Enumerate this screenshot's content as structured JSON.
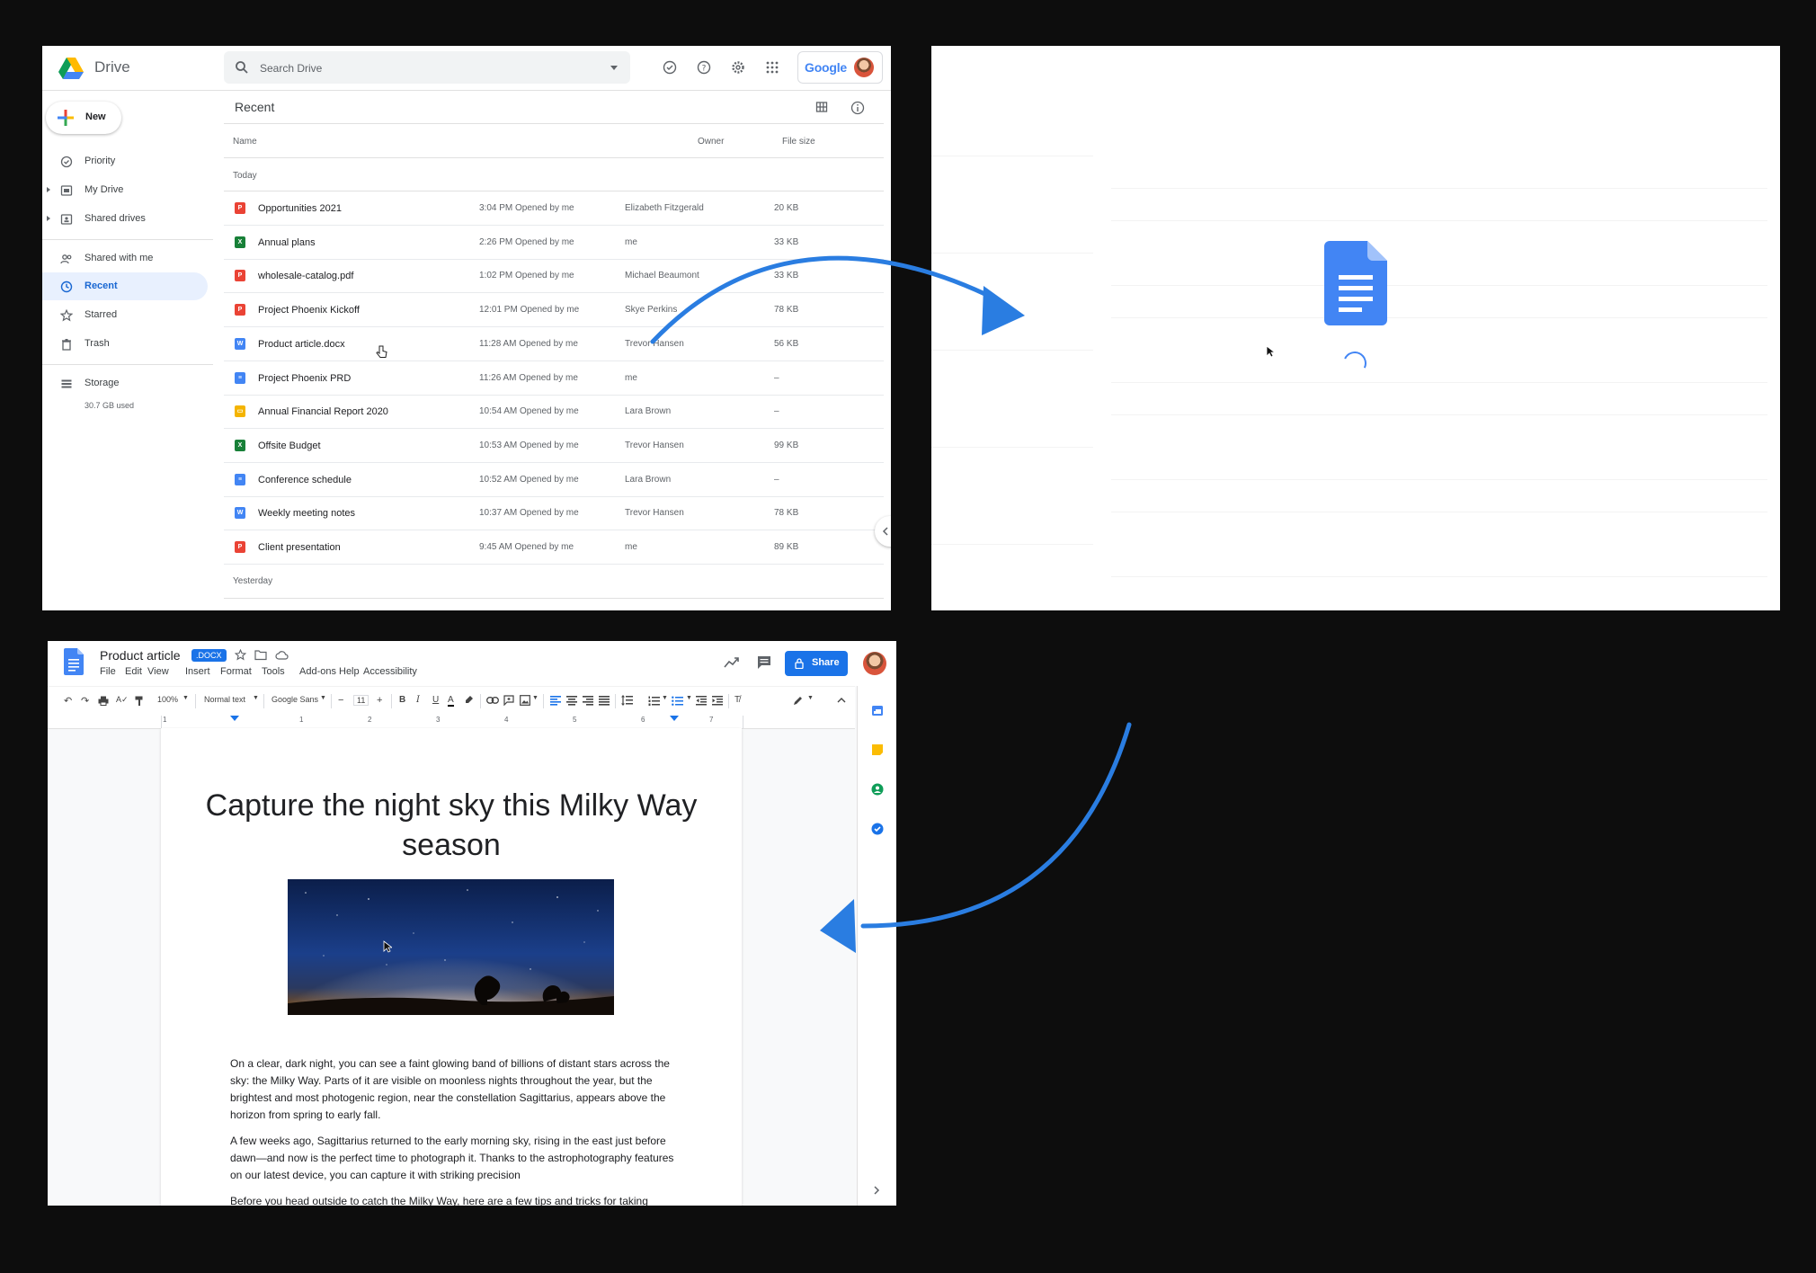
{
  "drive": {
    "app_name": "Drive",
    "search_placeholder": "Search Drive",
    "account_brand": "Google",
    "new_label": "New",
    "nav": [
      {
        "label": "Priority"
      },
      {
        "label": "My Drive"
      },
      {
        "label": "Shared drives"
      },
      {
        "label": "Shared with me"
      },
      {
        "label": "Recent"
      },
      {
        "label": "Starred"
      },
      {
        "label": "Trash"
      },
      {
        "label": "Storage"
      }
    ],
    "storage_used": "30.7 GB used",
    "section_title": "Recent",
    "columns": {
      "name": "Name",
      "owner": "Owner",
      "size": "File size"
    },
    "groups": {
      "today": "Today",
      "yesterday": "Yesterday"
    },
    "files": [
      {
        "name": "Opportunities 2021",
        "type": "slides",
        "color": "#ea4335",
        "time": "3:04 PM Opened by me",
        "owner": "Elizabeth Fitzgerald",
        "size": "20 KB"
      },
      {
        "name": "Annual plans",
        "type": "sheets",
        "color": "#188038",
        "time": "2:26 PM Opened by me",
        "owner": "me",
        "size": "33 KB"
      },
      {
        "name": "wholesale-catalog.pdf",
        "type": "pdf",
        "color": "#ea4335",
        "time": "1:02 PM Opened by me",
        "owner": "Michael Beaumont",
        "size": "33 KB"
      },
      {
        "name": "Project Phoenix Kickoff",
        "type": "slides",
        "color": "#ea4335",
        "time": "12:01 PM Opened by me",
        "owner": "Skye Perkins",
        "size": "78 KB"
      },
      {
        "name": "Product article.docx",
        "type": "word",
        "color": "#4285f4",
        "time": "11:28 AM Opened by me",
        "owner": "Trevor Hansen",
        "size": "56 KB"
      },
      {
        "name": "Project Phoenix PRD",
        "type": "docs",
        "color": "#4285f4",
        "time": "11:26 AM Opened by me",
        "owner": "me",
        "size": "–"
      },
      {
        "name": "Annual Financial Report 2020",
        "type": "slides-yellow",
        "color": "#f4b400",
        "time": "10:54 AM Opened by me",
        "owner": "Lara Brown",
        "size": "–"
      },
      {
        "name": "Offsite Budget",
        "type": "sheets",
        "color": "#188038",
        "time": "10:53 AM Opened by me",
        "owner": "Trevor Hansen",
        "size": "99 KB"
      },
      {
        "name": "Conference schedule",
        "type": "docs",
        "color": "#4285f4",
        "time": "10:52 AM Opened by me",
        "owner": "Lara Brown",
        "size": "–"
      },
      {
        "name": "Weekly meeting notes",
        "type": "word",
        "color": "#4285f4",
        "time": "10:37 AM Opened by me",
        "owner": "Trevor Hansen",
        "size": "78 KB"
      },
      {
        "name": "Client presentation",
        "type": "slides",
        "color": "#ea4335",
        "time": "9:45 AM Opened by me",
        "owner": "me",
        "size": "89 KB"
      }
    ]
  },
  "docs": {
    "doc_title": "Product article",
    "badge": ".DOCX",
    "menu": [
      "File",
      "Edit",
      "View",
      "Insert",
      "Format",
      "Tools",
      "Add-ons",
      "Help",
      "Accessibility"
    ],
    "share_label": "Share",
    "toolbar": {
      "zoom": "100%",
      "style": "Normal text",
      "font": "Google Sans",
      "font_size": "11"
    },
    "ruler": [
      "1",
      "1",
      "2",
      "3",
      "4",
      "5",
      "6",
      "7"
    ],
    "heading": "Capture the night sky this Milky Way season",
    "paragraphs": [
      "On a clear, dark night, you can see a faint glowing band of billions of distant stars across the sky: the Milky Way. Parts of it are visible on moonless nights throughout the year, but the brightest and most photogenic region, near the constellation Sagittarius, appears above the horizon from spring to early fall.",
      "A few weeks ago, Sagittarius returned to the early morning sky, rising in the east just before dawn—and now is the perfect time to photograph it. Thanks to the astrophotography features on our latest device, you can capture it with striking precision",
      "Before you head outside to catch the Milky Way, here are a few tips and tricks for taking breathtaking night time photos of your own."
    ]
  },
  "colors": {
    "accent": "#1a73e8",
    "background": "#0d0d0d",
    "arrow": "#2a7de1"
  }
}
